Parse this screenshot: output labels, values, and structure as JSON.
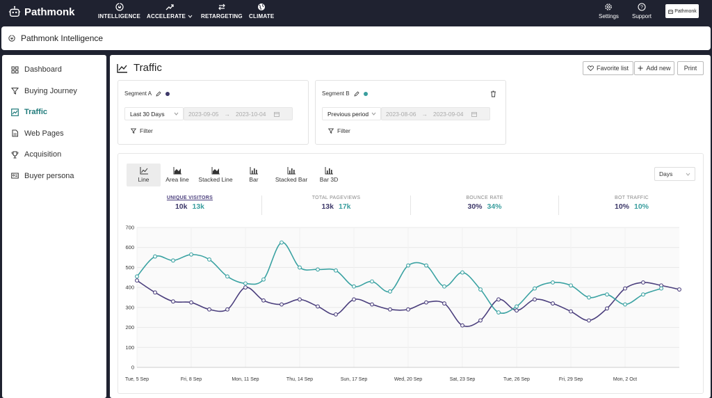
{
  "brand": {
    "name": "Pathmonk"
  },
  "nav": [
    {
      "label": "INTELLIGENCE"
    },
    {
      "label": "ACCELERATE"
    },
    {
      "label": "RETARGETING"
    },
    {
      "label": "CLIMATE"
    }
  ],
  "topbar_right": {
    "settings": "Settings",
    "support": "Support",
    "account": "Pathmonk"
  },
  "subheader": {
    "title": "Pathmonk Intelligence"
  },
  "sidebar": {
    "items": [
      {
        "label": "Dashboard",
        "icon": "grid-icon"
      },
      {
        "label": "Buying Journey",
        "icon": "funnel-icon"
      },
      {
        "label": "Traffic",
        "icon": "chart-line-icon",
        "active": true
      },
      {
        "label": "Web Pages",
        "icon": "page-icon"
      },
      {
        "label": "Acquisition",
        "icon": "trophy-icon"
      },
      {
        "label": "Buyer persona",
        "icon": "id-card-icon"
      }
    ]
  },
  "page": {
    "title": "Traffic"
  },
  "buttons": {
    "favorite": "Favorite list",
    "add_new": "Add new",
    "print": "Print"
  },
  "segments": {
    "a": {
      "title": "Segment A",
      "color": "#3d3869",
      "period": "Last 30 Days",
      "from": "2023-09-05",
      "to": "2023-10-04",
      "filter": "Filter"
    },
    "b": {
      "title": "Segment B",
      "color": "#3a9e9e",
      "period": "Previous period",
      "from": "2023-08-06",
      "to": "2023-09-04",
      "filter": "Filter"
    }
  },
  "chart_types": [
    {
      "label": "Line"
    },
    {
      "label": "Area line"
    },
    {
      "label": "Stacked Line"
    },
    {
      "label": "Bar"
    },
    {
      "label": "Stacked Bar"
    },
    {
      "label": "Bar 3D"
    }
  ],
  "granularity": "Days",
  "metrics": [
    {
      "label": "UNIQUE VISITORS",
      "a": "10k",
      "b": "13k"
    },
    {
      "label": "TOTAL PAGEVIEWS",
      "a": "13k",
      "b": "17k"
    },
    {
      "label": "BOUNCE RATE",
      "a": "30%",
      "b": "34%"
    },
    {
      "label": "BOT TRAFFIC",
      "a": "10%",
      "b": "10%"
    }
  ],
  "chart_data": {
    "type": "line",
    "ylim": [
      0,
      700
    ],
    "yticks": [
      0,
      100,
      200,
      300,
      400,
      500,
      600,
      700
    ],
    "x_tick_labels": [
      "Tue, 5 Sep",
      "Fri, 8 Sep",
      "Mon, 11 Sep",
      "Thu, 14 Sep",
      "Sun, 17 Sep",
      "Wed, 20 Sep",
      "Sat, 23 Sep",
      "Tue, 26 Sep",
      "Fri, 29 Sep",
      "Mon, 2 Oct"
    ],
    "colors": {
      "a": "#4b3f7d",
      "b": "#3aa2a2"
    },
    "series": [
      {
        "values": [
          435,
          375,
          330,
          325,
          290,
          290,
          400,
          335,
          315,
          340,
          305,
          265,
          340,
          315,
          290,
          290,
          325,
          320,
          210,
          235,
          340,
          285,
          340,
          320,
          280,
          235,
          295,
          395,
          425,
          410,
          390
        ]
      },
      {
        "values": [
          455,
          555,
          535,
          565,
          540,
          455,
          420,
          440,
          625,
          500,
          490,
          485,
          405,
          430,
          380,
          510,
          510,
          405,
          475,
          390,
          275,
          305,
          395,
          425,
          410,
          350,
          365,
          315,
          365,
          395
        ]
      }
    ]
  }
}
